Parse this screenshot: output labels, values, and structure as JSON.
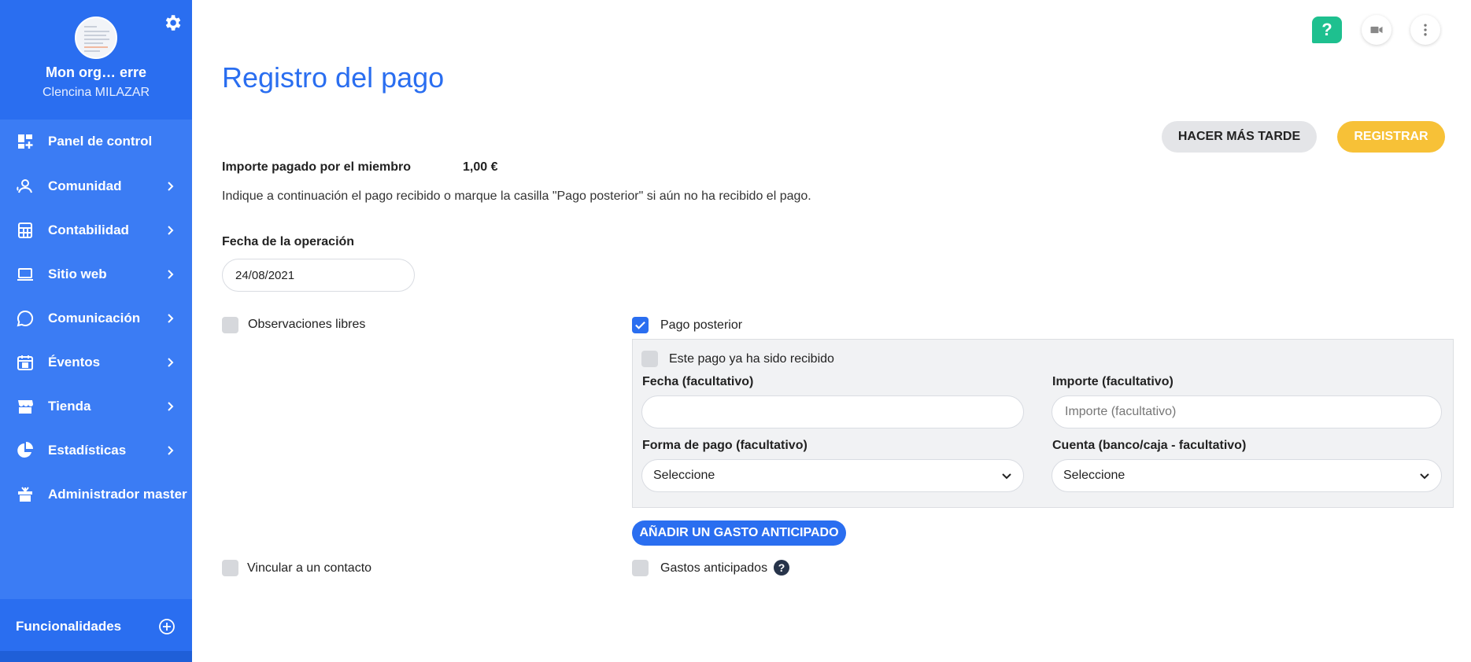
{
  "sidebar": {
    "org_name": "Mon org… erre",
    "user_name": "Clencina MILAZAR",
    "items": [
      {
        "label": "Panel de control",
        "icon": "dashboard-icon",
        "has_chevron": false
      },
      {
        "label": "Comunidad",
        "icon": "community-icon",
        "has_chevron": true
      },
      {
        "label": "Contabilidad",
        "icon": "calculator-icon",
        "has_chevron": true
      },
      {
        "label": "Sitio web",
        "icon": "laptop-icon",
        "has_chevron": true
      },
      {
        "label": "Comunicación",
        "icon": "chat-icon",
        "has_chevron": true
      },
      {
        "label": "Éventos",
        "icon": "calendar-icon",
        "has_chevron": true
      },
      {
        "label": "Tienda",
        "icon": "store-icon",
        "has_chevron": true
      },
      {
        "label": "Estadísticas",
        "icon": "pie-chart-icon",
        "has_chevron": true
      },
      {
        "label": "Administrador master",
        "icon": "gift-icon",
        "has_chevron": false
      }
    ],
    "features_label": "Funcionalidades"
  },
  "header": {
    "help_label": "?"
  },
  "page": {
    "title": "Registro del pago",
    "later_button": "HACER MÁS TARDE",
    "register_button": "REGISTRAR",
    "amount_label": "Importe pagado por el miembro",
    "amount_value": "1,00 €",
    "instructions": "Indique a continuación el pago recibido o marque la casilla \"Pago posterior\" si aún no ha recibido el pago.",
    "date_label": "Fecha de la operación",
    "date_value": "24/08/2021",
    "free_notes_label": "Observaciones libres",
    "later_payment_label": "Pago posterior",
    "later_payment_checked": true,
    "received_label": "Este pago ya ha sido recibido",
    "optional_date_label": "Fecha (facultativo)",
    "optional_date_value": "",
    "optional_amount_label": "Importe (facultativo)",
    "optional_amount_placeholder": "Importe (facultativo)",
    "payment_method_label": "Forma de pago (facultativo)",
    "payment_method_value": "Seleccione",
    "account_label": "Cuenta (banco/caja - facultativo)",
    "account_value": "Seleccione",
    "add_expense_button": "AÑADIR UN GASTO ANTICIPADO",
    "link_contact_label": "Vincular a un contacto",
    "advance_expenses_label": "Gastos anticipados",
    "help_mark": "?"
  },
  "colors": {
    "primary": "#2a6ef0",
    "accent": "#f7c137",
    "help": "#1ec08f"
  }
}
